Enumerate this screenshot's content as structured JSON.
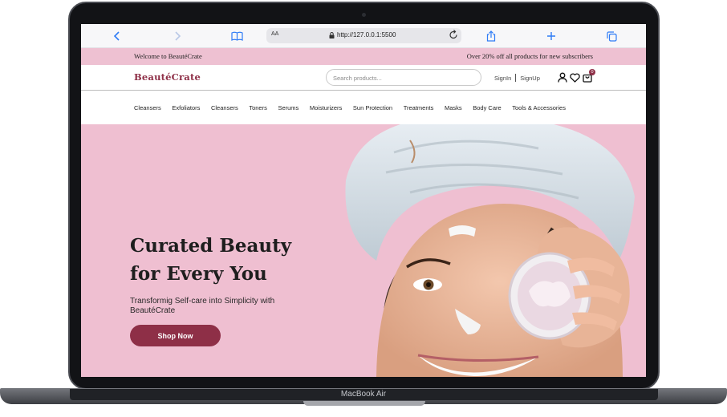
{
  "device": {
    "label": "MacBook Air"
  },
  "browser": {
    "text_size_label": "AA",
    "url": "http://127.0.0.1:5500",
    "icons": [
      "back-icon",
      "forward-icon",
      "book-icon",
      "lock-icon",
      "reload-icon",
      "share-icon",
      "plus-icon",
      "tabs-icon"
    ]
  },
  "promo": {
    "welcome": "Welcome to BeautéCrate",
    "offer": "Over 20% off all products for new subscribers"
  },
  "header": {
    "logo": "BeautéCrate",
    "search_placeholder": "Search products...",
    "signin": "SignIn",
    "signup": "SignUp",
    "cart_count": "0"
  },
  "categories": [
    "Cleansers",
    "Exfoliators",
    "Cleansers",
    "Toners",
    "Serums",
    "Moisturizers",
    "Sun Protection",
    "Treatments",
    "Masks",
    "Body Care",
    "Tools & Accessories"
  ],
  "hero": {
    "title_line1": "Curated Beauty",
    "title_line2": "for Every You",
    "subtitle": "Transformig Self-care into Simplicity with BeautéCrate",
    "cta": "Shop Now"
  },
  "colors": {
    "brand": "#8e2f47",
    "promo_bg": "#eec1d2",
    "hero_bg": "#efbfd1",
    "browser_accent": "#2f7cf6"
  }
}
